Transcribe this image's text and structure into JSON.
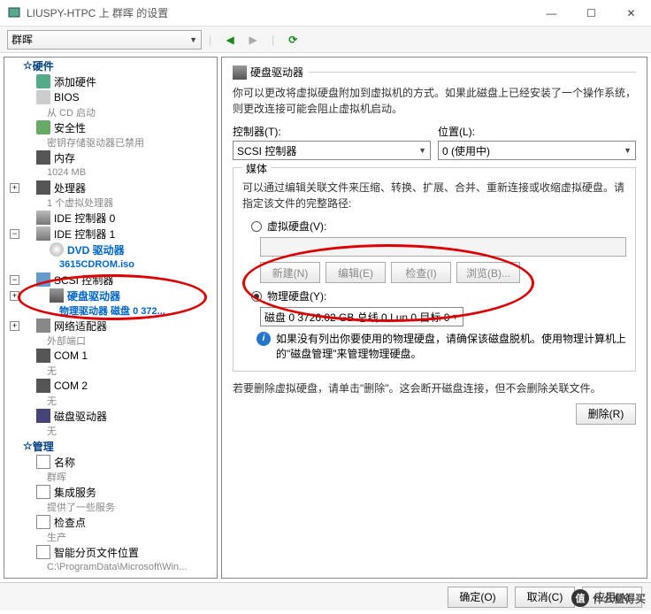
{
  "window": {
    "title": "LIUSPY-HTPC 上 群晖 的设置",
    "min": "—",
    "max": "☐",
    "close": "✕"
  },
  "toolbar": {
    "dropdown": "群晖",
    "back": "◀",
    "forward": "▶",
    "refresh": "⟳"
  },
  "tree": {
    "hardware": "硬件",
    "add_hw": "添加硬件",
    "bios": "BIOS",
    "bios_sub": "从 CD 启动",
    "security": "安全性",
    "security_sub": "密钥存储驱动器已禁用",
    "memory": "内存",
    "memory_sub": "1024 MB",
    "cpu": "处理器",
    "cpu_sub": "1 个虚拟处理器",
    "ide0": "IDE 控制器 0",
    "ide1": "IDE 控制器 1",
    "dvd": "DVD 驱动器",
    "dvd_sub": "3615CDROM.iso",
    "scsi": "SCSI 控制器",
    "hdd": "硬盘驱动器",
    "hdd_sub": "物理驱动器 磁盘 0 372...",
    "net": "网络适配器",
    "net_sub": "外部端口",
    "com1": "COM 1",
    "com1_sub": "无",
    "com2": "COM 2",
    "com2_sub": "无",
    "floppy": "磁盘驱动器",
    "floppy_sub": "无",
    "management": "管理",
    "name": "名称",
    "name_sub": "群晖",
    "svc": "集成服务",
    "svc_sub": "提供了一些服务",
    "chk": "检查点",
    "chk_sub": "生产",
    "page": "智能分页文件位置",
    "page_sub": "C:\\ProgramData\\Microsoft\\Win..."
  },
  "detail": {
    "title": "硬盘驱动器",
    "desc": "你可以更改将虚拟硬盘附加到虚拟机的方式。如果此磁盘上已经安装了一个操作系统，则更改连接可能会阻止虚拟机启动。",
    "ctrl_label": "控制器(T):",
    "ctrl_value": "SCSI 控制器",
    "loc_label": "位置(L):",
    "loc_value": "0 (使用中)",
    "media": "媒体",
    "media_desc": "可以通过编辑关联文件来压缩、转换、扩展、合并、重新连接或收缩虚拟硬盘。请指定该文件的完整路径:",
    "virtual_disk": "虚拟硬盘(V):",
    "new_btn": "新建(N)",
    "edit_btn": "编辑(E)",
    "inspect_btn": "检查(I)",
    "browse_btn": "浏览(B)...",
    "physical_disk": "物理硬盘(Y):",
    "phys_value": "磁盘 0 3726.02 GB 总线 0 Lun 0 目标 0",
    "info_text": "如果没有列出你要使用的物理硬盘，请确保该磁盘脱机。使用物理计算机上的\"磁盘管理\"来管理物理硬盘。",
    "remove_text": "若要删除虚拟硬盘，请单击\"删除\"。这会断开磁盘连接，但不会删除关联文件。",
    "remove_btn": "删除(R)"
  },
  "footer": {
    "ok": "确定(O)",
    "cancel": "取消(C)",
    "apply": "应用(A)"
  },
  "watermark": "什么值得买"
}
